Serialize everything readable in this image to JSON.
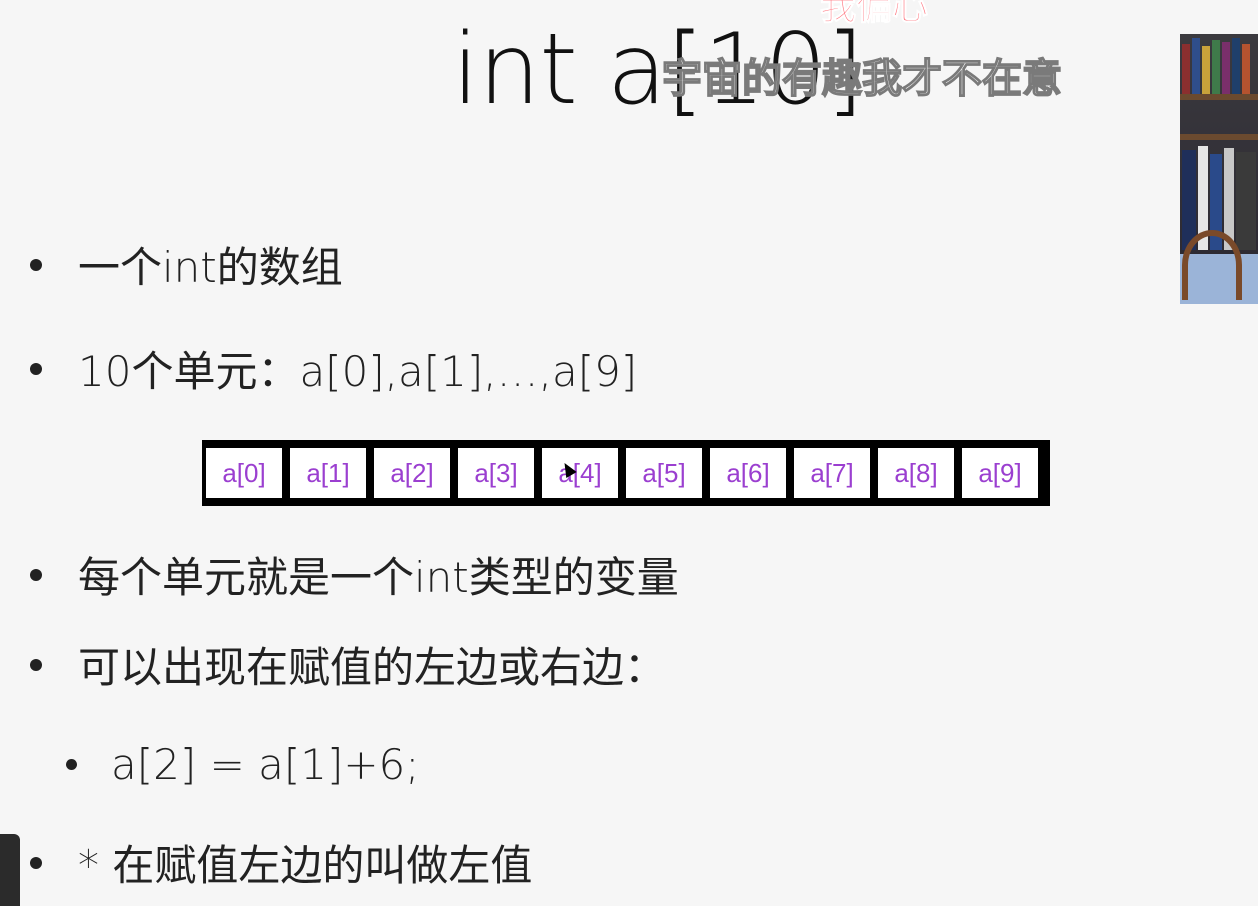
{
  "slide": {
    "title": "int a[10]",
    "bullets": [
      "一个int的数组",
      "10个单元：a[0],a[1],…,a[9]",
      "每个单元就是一个int类型的变量",
      "可以出现在赋值的左边或右边："
    ],
    "sub_bullet": "a[2] = a[1]+6;",
    "last_bullet": " * 在赋值左边的叫做左值",
    "array_cells": [
      "a[0]",
      "a[1]",
      "a[2]",
      "a[3]",
      "a[4]",
      "a[5]",
      "a[6]",
      "a[7]",
      "a[8]",
      "a[9]"
    ]
  },
  "overlay": {
    "danmaku_top": "我偏心",
    "danmaku_main": "宇宙的有趣我才不在意"
  },
  "colors": {
    "cell_text": "#9b3fd0",
    "danmaku_top": "#ff6f7a"
  },
  "icons": {
    "cursor": "mouse-pointer-icon"
  }
}
